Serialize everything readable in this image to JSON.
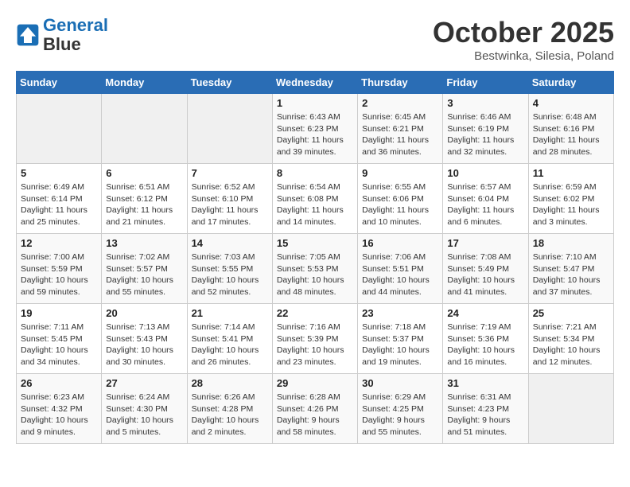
{
  "header": {
    "logo_line1": "General",
    "logo_line2": "Blue",
    "month": "October 2025",
    "location": "Bestwinka, Silesia, Poland"
  },
  "days_of_week": [
    "Sunday",
    "Monday",
    "Tuesday",
    "Wednesday",
    "Thursday",
    "Friday",
    "Saturday"
  ],
  "weeks": [
    [
      {
        "num": "",
        "info": ""
      },
      {
        "num": "",
        "info": ""
      },
      {
        "num": "",
        "info": ""
      },
      {
        "num": "1",
        "info": "Sunrise: 6:43 AM\nSunset: 6:23 PM\nDaylight: 11 hours\nand 39 minutes."
      },
      {
        "num": "2",
        "info": "Sunrise: 6:45 AM\nSunset: 6:21 PM\nDaylight: 11 hours\nand 36 minutes."
      },
      {
        "num": "3",
        "info": "Sunrise: 6:46 AM\nSunset: 6:19 PM\nDaylight: 11 hours\nand 32 minutes."
      },
      {
        "num": "4",
        "info": "Sunrise: 6:48 AM\nSunset: 6:16 PM\nDaylight: 11 hours\nand 28 minutes."
      }
    ],
    [
      {
        "num": "5",
        "info": "Sunrise: 6:49 AM\nSunset: 6:14 PM\nDaylight: 11 hours\nand 25 minutes."
      },
      {
        "num": "6",
        "info": "Sunrise: 6:51 AM\nSunset: 6:12 PM\nDaylight: 11 hours\nand 21 minutes."
      },
      {
        "num": "7",
        "info": "Sunrise: 6:52 AM\nSunset: 6:10 PM\nDaylight: 11 hours\nand 17 minutes."
      },
      {
        "num": "8",
        "info": "Sunrise: 6:54 AM\nSunset: 6:08 PM\nDaylight: 11 hours\nand 14 minutes."
      },
      {
        "num": "9",
        "info": "Sunrise: 6:55 AM\nSunset: 6:06 PM\nDaylight: 11 hours\nand 10 minutes."
      },
      {
        "num": "10",
        "info": "Sunrise: 6:57 AM\nSunset: 6:04 PM\nDaylight: 11 hours\nand 6 minutes."
      },
      {
        "num": "11",
        "info": "Sunrise: 6:59 AM\nSunset: 6:02 PM\nDaylight: 11 hours\nand 3 minutes."
      }
    ],
    [
      {
        "num": "12",
        "info": "Sunrise: 7:00 AM\nSunset: 5:59 PM\nDaylight: 10 hours\nand 59 minutes."
      },
      {
        "num": "13",
        "info": "Sunrise: 7:02 AM\nSunset: 5:57 PM\nDaylight: 10 hours\nand 55 minutes."
      },
      {
        "num": "14",
        "info": "Sunrise: 7:03 AM\nSunset: 5:55 PM\nDaylight: 10 hours\nand 52 minutes."
      },
      {
        "num": "15",
        "info": "Sunrise: 7:05 AM\nSunset: 5:53 PM\nDaylight: 10 hours\nand 48 minutes."
      },
      {
        "num": "16",
        "info": "Sunrise: 7:06 AM\nSunset: 5:51 PM\nDaylight: 10 hours\nand 44 minutes."
      },
      {
        "num": "17",
        "info": "Sunrise: 7:08 AM\nSunset: 5:49 PM\nDaylight: 10 hours\nand 41 minutes."
      },
      {
        "num": "18",
        "info": "Sunrise: 7:10 AM\nSunset: 5:47 PM\nDaylight: 10 hours\nand 37 minutes."
      }
    ],
    [
      {
        "num": "19",
        "info": "Sunrise: 7:11 AM\nSunset: 5:45 PM\nDaylight: 10 hours\nand 34 minutes."
      },
      {
        "num": "20",
        "info": "Sunrise: 7:13 AM\nSunset: 5:43 PM\nDaylight: 10 hours\nand 30 minutes."
      },
      {
        "num": "21",
        "info": "Sunrise: 7:14 AM\nSunset: 5:41 PM\nDaylight: 10 hours\nand 26 minutes."
      },
      {
        "num": "22",
        "info": "Sunrise: 7:16 AM\nSunset: 5:39 PM\nDaylight: 10 hours\nand 23 minutes."
      },
      {
        "num": "23",
        "info": "Sunrise: 7:18 AM\nSunset: 5:37 PM\nDaylight: 10 hours\nand 19 minutes."
      },
      {
        "num": "24",
        "info": "Sunrise: 7:19 AM\nSunset: 5:36 PM\nDaylight: 10 hours\nand 16 minutes."
      },
      {
        "num": "25",
        "info": "Sunrise: 7:21 AM\nSunset: 5:34 PM\nDaylight: 10 hours\nand 12 minutes."
      }
    ],
    [
      {
        "num": "26",
        "info": "Sunrise: 6:23 AM\nSunset: 4:32 PM\nDaylight: 10 hours\nand 9 minutes."
      },
      {
        "num": "27",
        "info": "Sunrise: 6:24 AM\nSunset: 4:30 PM\nDaylight: 10 hours\nand 5 minutes."
      },
      {
        "num": "28",
        "info": "Sunrise: 6:26 AM\nSunset: 4:28 PM\nDaylight: 10 hours\nand 2 minutes."
      },
      {
        "num": "29",
        "info": "Sunrise: 6:28 AM\nSunset: 4:26 PM\nDaylight: 9 hours\nand 58 minutes."
      },
      {
        "num": "30",
        "info": "Sunrise: 6:29 AM\nSunset: 4:25 PM\nDaylight: 9 hours\nand 55 minutes."
      },
      {
        "num": "31",
        "info": "Sunrise: 6:31 AM\nSunset: 4:23 PM\nDaylight: 9 hours\nand 51 minutes."
      },
      {
        "num": "",
        "info": ""
      }
    ]
  ]
}
